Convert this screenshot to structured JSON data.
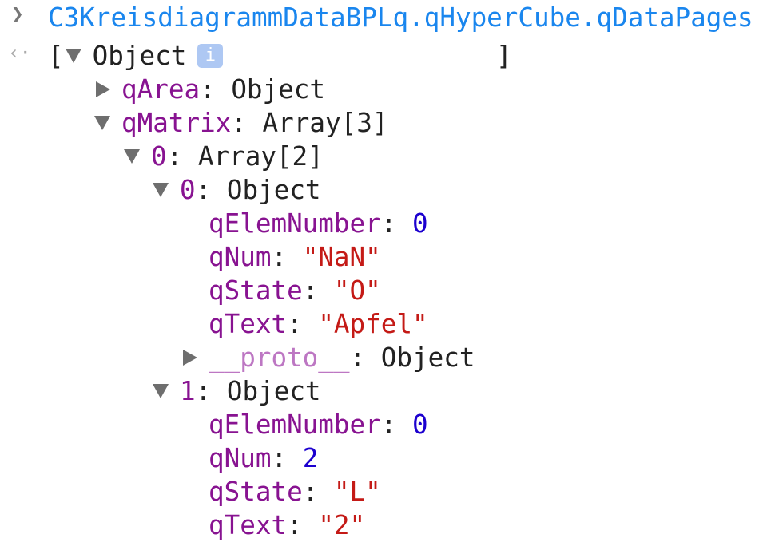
{
  "input": {
    "prompt_icon": "chevron-right-icon",
    "expression": "C3KreisdiagrammDataBPLq.qHyperCube.qDataPages"
  },
  "result": {
    "return_icon": "return-arrow-icon",
    "open_bracket": "[",
    "close_bracket": "]",
    "root_label": "Object",
    "info_label": "i",
    "rows": [
      {
        "key": "qArea",
        "sep": ": ",
        "value": "Object"
      },
      {
        "key": "qMatrix",
        "sep": ": ",
        "value": "Array[3]"
      },
      {
        "key": "0",
        "sep": ": ",
        "value": "Array[2]"
      },
      {
        "key": "0",
        "sep": ": ",
        "value": "Object"
      },
      {
        "key": "qElemNumber",
        "sep": ": ",
        "value": "0"
      },
      {
        "key": "qNum",
        "sep": ": ",
        "value": "\"NaN\""
      },
      {
        "key": "qState",
        "sep": ": ",
        "value": "\"O\""
      },
      {
        "key": "qText",
        "sep": ": ",
        "value": "\"Apfel\""
      },
      {
        "key": "__proto__",
        "sep": ": ",
        "value": "Object"
      },
      {
        "key": "1",
        "sep": ": ",
        "value": "Object"
      },
      {
        "key": "qElemNumber",
        "sep": ": ",
        "value": "0"
      },
      {
        "key": "qNum",
        "sep": ": ",
        "value": "2"
      },
      {
        "key": "qState",
        "sep": ": ",
        "value": "\"L\""
      },
      {
        "key": "qText",
        "sep": ": ",
        "value": "\"2\""
      }
    ]
  },
  "colors": {
    "command": "#1a86ee",
    "key": "#881391",
    "number": "#1c00cf",
    "string": "#c41a16"
  }
}
